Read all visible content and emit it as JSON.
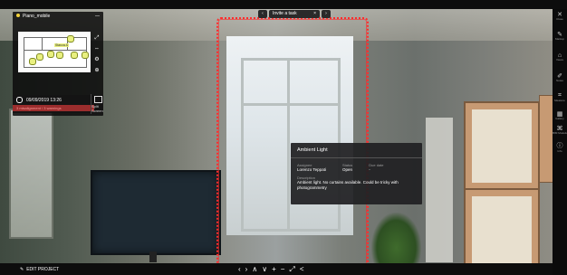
{
  "panel": {
    "title": "Piano_mobile",
    "minimize": "—",
    "minimap_pin_label": "Stanza A",
    "timestamp": "09/09/2019 13:26",
    "warning": "3 misalignment / 3 warnings",
    "split_label": "Split Screen"
  },
  "top_nav": {
    "prev": "‹",
    "label": "Invite a task",
    "close": "×",
    "next": "›"
  },
  "card": {
    "title": "Ambient Light",
    "assignee_label": "Assignee",
    "assignee": "Lorenzo Teppati",
    "status_label": "Status",
    "status": "Open",
    "due_label": "Due date",
    "due": "-",
    "description_label": "Description",
    "description": "Ambient light. No curtains available. Could be tricky with photogrammetry"
  },
  "sidebar": {
    "items": [
      {
        "icon": "✕",
        "label": "Close"
      },
      {
        "icon": "✎",
        "label": "Markup"
      },
      {
        "icon": "⌂",
        "label": "Views"
      },
      {
        "icon": "✐",
        "label": "Notes"
      },
      {
        "icon": "⌗",
        "label": "Measure"
      },
      {
        "icon": "▦",
        "label": "Gallery"
      },
      {
        "icon": "⌘",
        "label": "BIM Models"
      },
      {
        "icon": "ⓘ",
        "label": "Info"
      }
    ]
  },
  "bottom": {
    "edit_project": "EDIT PROJECT",
    "controls": [
      "‹",
      "›",
      "∧",
      "∨",
      "+",
      "−",
      "⤢",
      "<"
    ]
  },
  "colors": {
    "highlight": "#ff2d2d",
    "pin": "#e9f080",
    "warning_bg": "#9b2d2d"
  }
}
